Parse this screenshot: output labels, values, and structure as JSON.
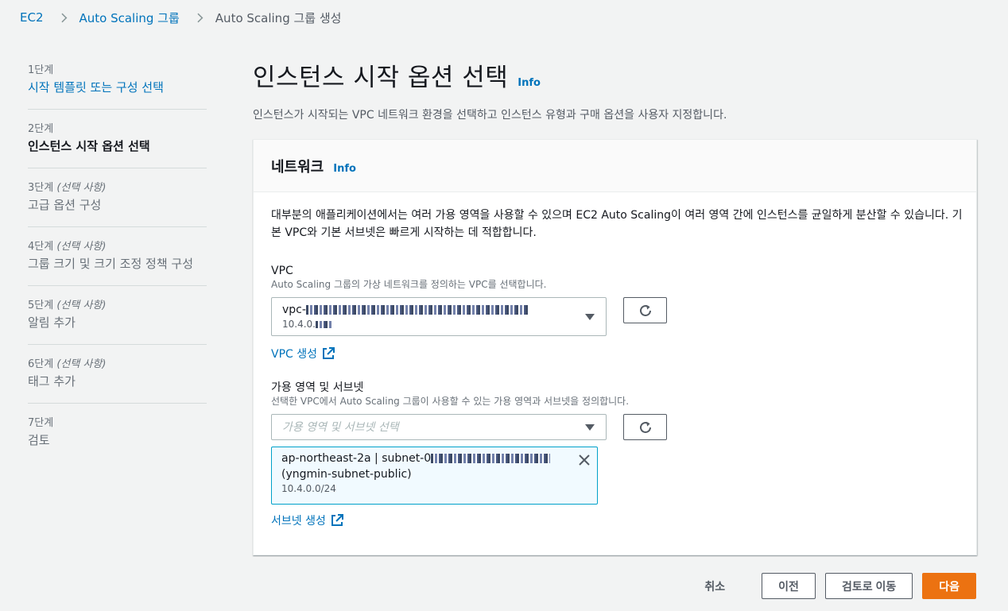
{
  "breadcrumb": {
    "items": [
      "EC2",
      "Auto Scaling 그룹",
      "Auto Scaling 그룹 생성"
    ]
  },
  "steps": [
    {
      "num": "1단계",
      "optional": "",
      "title": "시작 템플릿 또는 구성 선택",
      "state": "link"
    },
    {
      "num": "2단계",
      "optional": "",
      "title": "인스턴스 시작 옵션 선택",
      "state": "active"
    },
    {
      "num": "3단계",
      "optional": "(선택 사항)",
      "title": "고급 옵션 구성",
      "state": "disabled"
    },
    {
      "num": "4단계",
      "optional": "(선택 사항)",
      "title": "그룹 크기 및 크기 조정 정책 구성",
      "state": "disabled"
    },
    {
      "num": "5단계",
      "optional": "(선택 사항)",
      "title": "알림 추가",
      "state": "disabled"
    },
    {
      "num": "6단계",
      "optional": "(선택 사항)",
      "title": "태그 추가",
      "state": "disabled"
    },
    {
      "num": "7단계",
      "optional": "",
      "title": "검토",
      "state": "disabled"
    }
  ],
  "page": {
    "title": "인스턴스 시작 옵션 선택",
    "info": "Info",
    "description": "인스턴스가 시작되는 VPC 네트워크 환경을 선택하고 인스턴스 유형과 구매 옵션을 사용자 지정합니다."
  },
  "network": {
    "title": "네트워크",
    "info": "Info",
    "description": "대부분의 애플리케이션에서는 여러 가용 영역을 사용할 수 있으며 EC2 Auto Scaling이 여러 영역 간에 인스턴스를 균일하게 분산할 수 있습니다. 기본 VPC와 기본 서브넷은 빠르게 시작하는 데 적합합니다.",
    "vpc": {
      "label": "VPC",
      "description": "Auto Scaling 그룹의 가상 네트워크를 정의하는 VPC를 선택합니다.",
      "selected_prefix": "vpc-",
      "selected_cidr": "10.4.0.",
      "create_link": "VPC 생성"
    },
    "az": {
      "label": "가용 영역 및 서브넷",
      "description": "선택한 VPC에서 Auto Scaling 그룹이 사용할 수 있는 가용 영역과 서브넷을 정의합니다.",
      "placeholder": "가용 영역 및 서브넷 선택",
      "token_primary_prefix": "ap-northeast-2a | subnet-0",
      "token_name": "(yngmin-subnet-public)",
      "token_cidr": "10.4.0.0/24",
      "create_link": "서브넷 생성"
    }
  },
  "footer": {
    "cancel": "취소",
    "previous": "이전",
    "skip_to_review": "검토로 이동",
    "next": "다음"
  },
  "colors": {
    "link": "#0073bb",
    "primary_button": "#ec7211",
    "token_border": "#00a1c9",
    "token_bg": "#f1faff"
  }
}
